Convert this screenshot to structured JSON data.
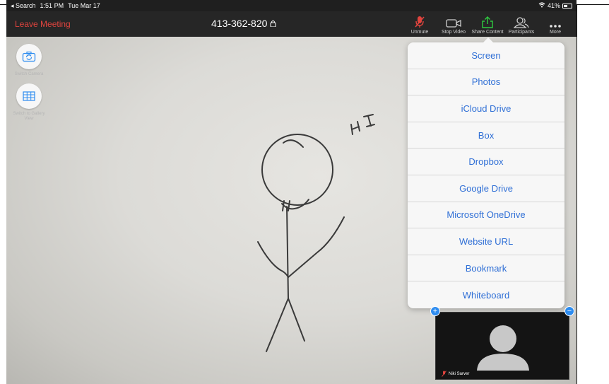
{
  "status": {
    "back_label": "◂ Search",
    "time": "1:51 PM",
    "date": "Tue Mar 17",
    "battery": "41%"
  },
  "toolbar": {
    "leave_label": "Leave Meeting",
    "meeting_id": "413-362-820",
    "unmute_label": "Unmute",
    "stop_video_label": "Stop Video",
    "share_content_label": "Share Content",
    "participants_label": "Participants",
    "more_label": "More"
  },
  "side": {
    "switch_camera_label": "Switch Camera",
    "gallery_label": "Switch to Gallery View"
  },
  "share_menu": {
    "items": [
      "Screen",
      "Photos",
      "iCloud Drive",
      "Box",
      "Dropbox",
      "Google Drive",
      "Microsoft OneDrive",
      "Website URL",
      "Bookmark",
      "Whiteboard"
    ]
  },
  "video": {
    "drawing_text": "HI"
  },
  "thumbnail": {
    "name": "Niki Sarver"
  },
  "colors": {
    "leave": "#e0443e",
    "share_green": "#2ecc40",
    "menu_link": "#2f6fd6",
    "toolbar_bg": "#262626"
  }
}
